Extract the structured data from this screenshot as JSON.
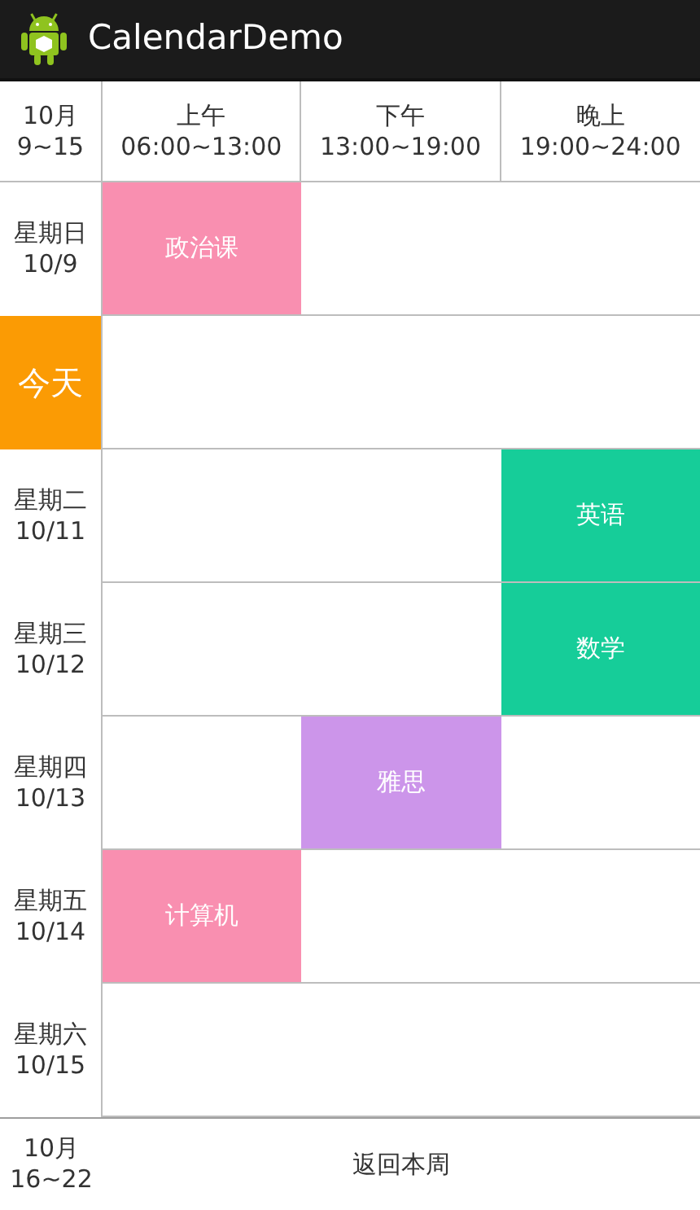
{
  "app_bar": {
    "title": "CalendarDemo"
  },
  "header": {
    "week": [
      "10月",
      "9~15"
    ],
    "periods": [
      {
        "name": "上午",
        "time": "06:00~13:00"
      },
      {
        "name": "下午",
        "time": "13:00~19:00"
      },
      {
        "name": "晚上",
        "time": "19:00~24:00"
      }
    ]
  },
  "days": [
    {
      "today": false,
      "lines": [
        "星期日",
        "10/9"
      ],
      "slots": [
        {
          "kind": "course",
          "label": "政治课",
          "color": "#f98fb0"
        },
        {
          "kind": "empty"
        },
        {
          "kind": "empty"
        }
      ]
    },
    {
      "today": true,
      "lines": [
        "今天"
      ],
      "slots": [
        {
          "kind": "empty"
        },
        {
          "kind": "empty"
        },
        {
          "kind": "empty"
        }
      ]
    },
    {
      "today": false,
      "lines": [
        "星期二",
        "10/11"
      ],
      "slots": [
        {
          "kind": "empty"
        },
        {
          "kind": "empty"
        },
        {
          "kind": "course",
          "label": "英语",
          "color": "#16cd99"
        }
      ]
    },
    {
      "today": false,
      "lines": [
        "星期三",
        "10/12"
      ],
      "slots": [
        {
          "kind": "empty"
        },
        {
          "kind": "empty"
        },
        {
          "kind": "course",
          "label": "数学",
          "color": "#16cd99"
        }
      ]
    },
    {
      "today": false,
      "lines": [
        "星期四",
        "10/13"
      ],
      "slots": [
        {
          "kind": "empty"
        },
        {
          "kind": "course",
          "label": "雅思",
          "color": "#cc95ea"
        },
        {
          "kind": "empty"
        }
      ]
    },
    {
      "today": false,
      "lines": [
        "星期五",
        "10/14"
      ],
      "slots": [
        {
          "kind": "course",
          "label": "计算机",
          "color": "#f98fb0"
        },
        {
          "kind": "empty"
        },
        {
          "kind": "empty"
        }
      ]
    },
    {
      "today": false,
      "lines": [
        "星期六",
        "10/15"
      ],
      "slots": [
        {
          "kind": "empty"
        },
        {
          "kind": "empty"
        },
        {
          "kind": "empty"
        }
      ]
    }
  ],
  "footer": {
    "next_week": [
      "10月",
      "16~22"
    ],
    "back_button": "返回本周"
  }
}
